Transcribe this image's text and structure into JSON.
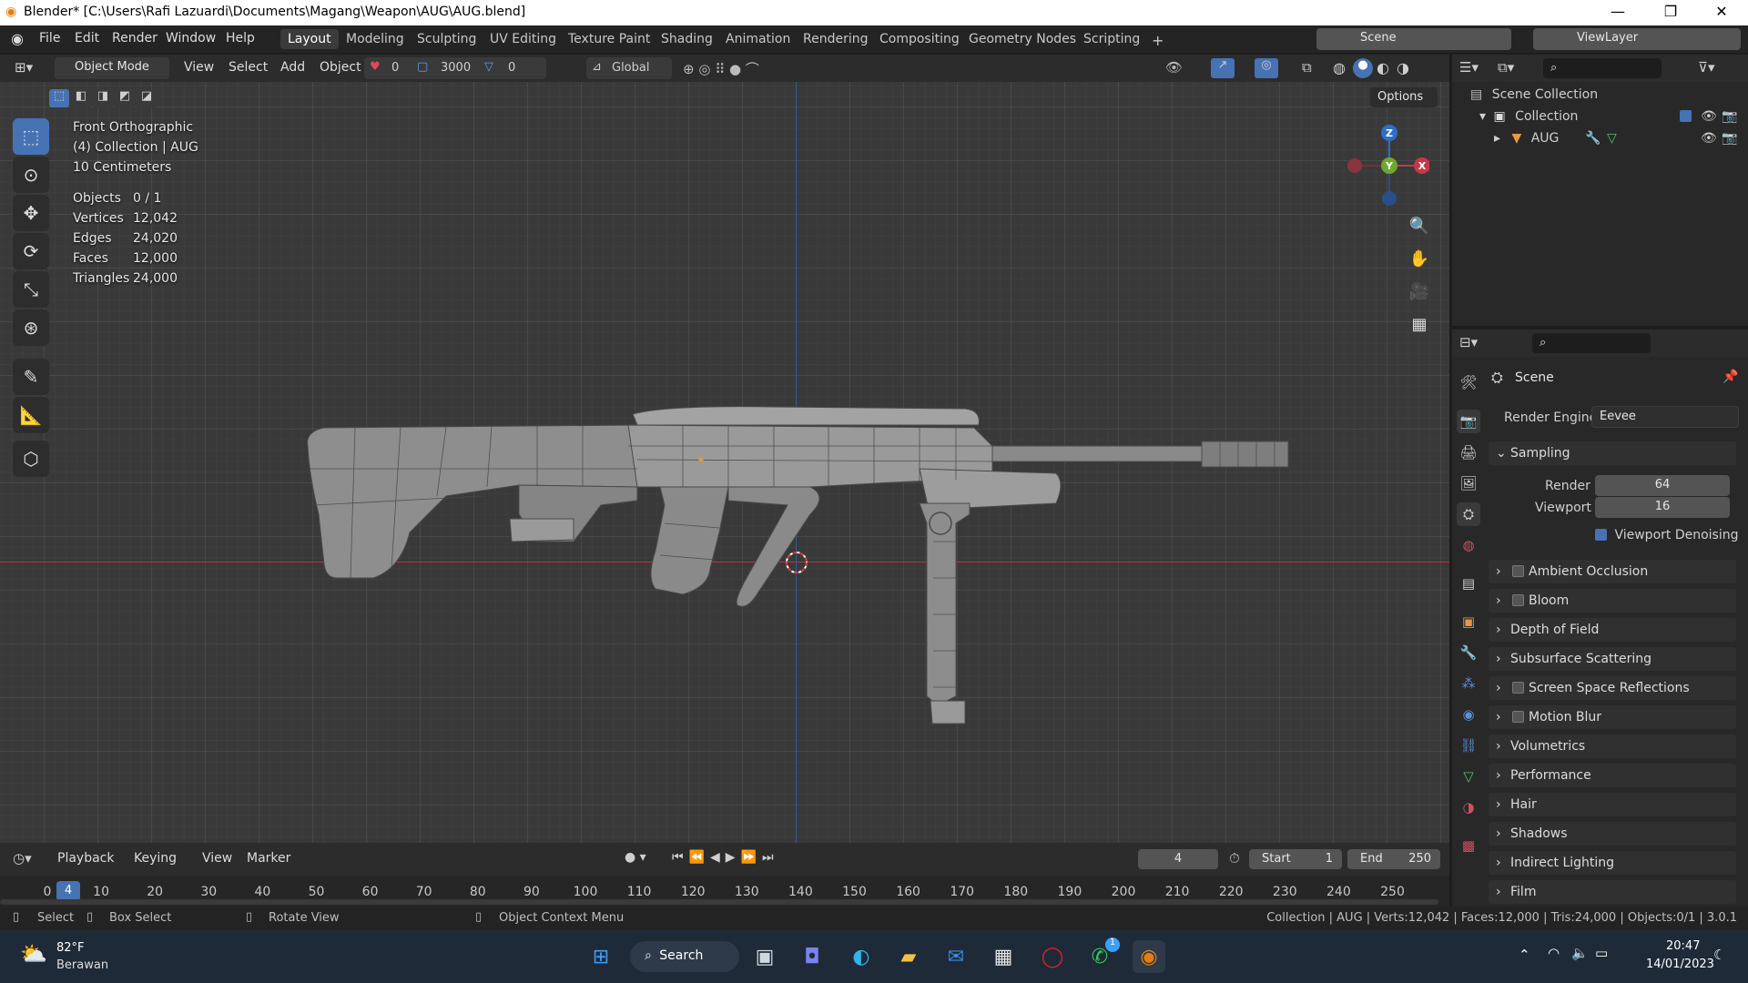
{
  "window": {
    "title": "Blender* [C:\\Users\\Rafi Lazuardi\\Documents\\Magang\\Weapon\\AUG\\AUG.blend]",
    "minimize": "—",
    "maximize": "❐",
    "close": "✕"
  },
  "menu": [
    "File",
    "Edit",
    "Render",
    "Window",
    "Help"
  ],
  "workspaces": [
    "Layout",
    "Modeling",
    "Sculpting",
    "UV Editing",
    "Texture Paint",
    "Shading",
    "Animation",
    "Rendering",
    "Compositing",
    "Geometry Nodes",
    "Scripting"
  ],
  "active_workspace": "Layout",
  "scene_name": "Scene",
  "view_layer": "ViewLayer",
  "viewport_header": {
    "mode": "Object Mode",
    "menus": [
      "View",
      "Select",
      "Add",
      "Object"
    ],
    "count_a": "0",
    "count_b": "3000",
    "count_c": "0",
    "orientation": "Global",
    "options": "Options"
  },
  "overlay": {
    "view_name": "Front Orthographic",
    "collection_info": "(4) Collection | AUG",
    "scale": "10 Centimeters",
    "stats": [
      {
        "label": "Objects",
        "value": "0 / 1"
      },
      {
        "label": "Vertices",
        "value": "12,042"
      },
      {
        "label": "Edges",
        "value": "24,020"
      },
      {
        "label": "Faces",
        "value": "12,000"
      },
      {
        "label": "Triangles",
        "value": "24,000"
      }
    ]
  },
  "gizmo": {
    "z": "Z",
    "y": "Y",
    "x": "X"
  },
  "outliner": {
    "root": "Scene Collection",
    "collection": "Collection",
    "object": "AUG"
  },
  "properties": {
    "context": "Scene",
    "render_engine_label": "Render Engine",
    "render_engine": "Eevee",
    "sampling": "Sampling",
    "render_label": "Render",
    "render_value": "64",
    "viewport_label": "Viewport",
    "viewport_value": "16",
    "denoise_label": "Viewport Denoising",
    "panels": [
      {
        "label": "Ambient Occlusion",
        "checkbox": true
      },
      {
        "label": "Bloom",
        "checkbox": true
      },
      {
        "label": "Depth of Field",
        "checkbox": false
      },
      {
        "label": "Subsurface Scattering",
        "checkbox": false
      },
      {
        "label": "Screen Space Reflections",
        "checkbox": true
      },
      {
        "label": "Motion Blur",
        "checkbox": true
      },
      {
        "label": "Volumetrics",
        "checkbox": false
      },
      {
        "label": "Performance",
        "checkbox": false
      },
      {
        "label": "Hair",
        "checkbox": false
      },
      {
        "label": "Shadows",
        "checkbox": false
      },
      {
        "label": "Indirect Lighting",
        "checkbox": false
      },
      {
        "label": "Film",
        "checkbox": false
      }
    ]
  },
  "timeline": {
    "menus": [
      "Playback",
      "Keying",
      "View",
      "Marker"
    ],
    "current_frame": "4",
    "start_label": "Start",
    "start": "1",
    "end_label": "End",
    "end": "250",
    "ticks": [
      "0",
      "10",
      "20",
      "30",
      "40",
      "50",
      "60",
      "70",
      "80",
      "90",
      "100",
      "110",
      "120",
      "130",
      "140",
      "150",
      "160",
      "170",
      "180",
      "190",
      "200",
      "210",
      "220",
      "230",
      "240",
      "250"
    ],
    "playhead": "4"
  },
  "statusbar": {
    "select": "Select",
    "box_select": "Box Select",
    "rotate": "Rotate View",
    "context_menu": "Object Context Menu",
    "stats": "Collection | AUG | Verts:12,042 | Faces:12,000 | Tris:24,000 | Objects:0/1 | 3.0.1"
  },
  "taskbar": {
    "temp": "82°F",
    "weather": "Berawan",
    "search": "Search",
    "time": "20:47",
    "date": "14/01/2023",
    "badge": "1"
  }
}
